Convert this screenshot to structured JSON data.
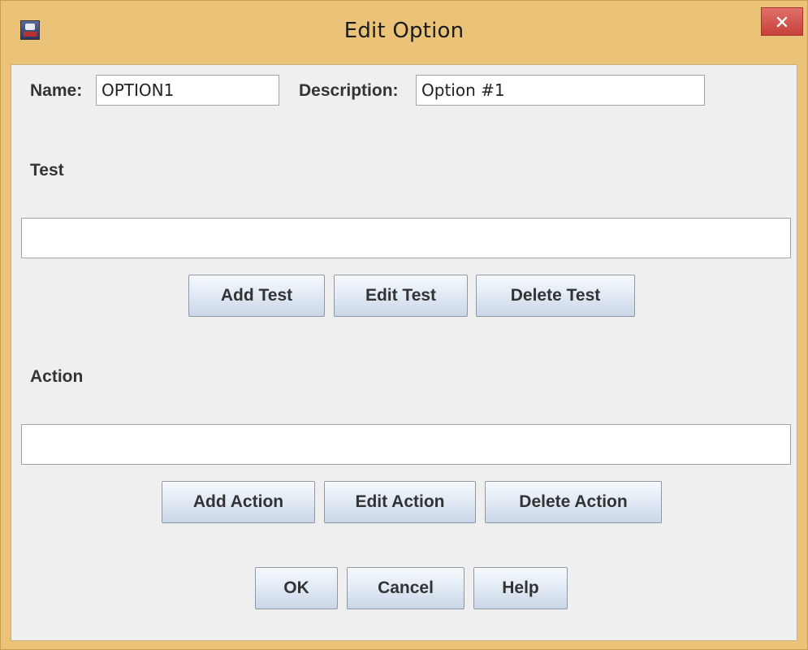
{
  "window": {
    "title": "Edit Option",
    "app_icon": "java-app-icon",
    "close_icon": "close-x-icon"
  },
  "form": {
    "name_label": "Name:",
    "name_value": "OPTION1",
    "description_label": "Description:",
    "description_value": "Option #1"
  },
  "test_section": {
    "heading": "Test",
    "list_value": "",
    "buttons": {
      "add": "Add Test",
      "edit": "Edit Test",
      "delete": "Delete Test"
    }
  },
  "action_section": {
    "heading": "Action",
    "list_value": "",
    "buttons": {
      "add": "Add Action",
      "edit": "Edit Action",
      "delete": "Delete Action"
    }
  },
  "dialog_buttons": {
    "ok": "OK",
    "cancel": "Cancel",
    "help": "Help"
  },
  "colors": {
    "titlebar": "#eac379",
    "close_button": "#c7403a",
    "client_background": "#efefef"
  }
}
